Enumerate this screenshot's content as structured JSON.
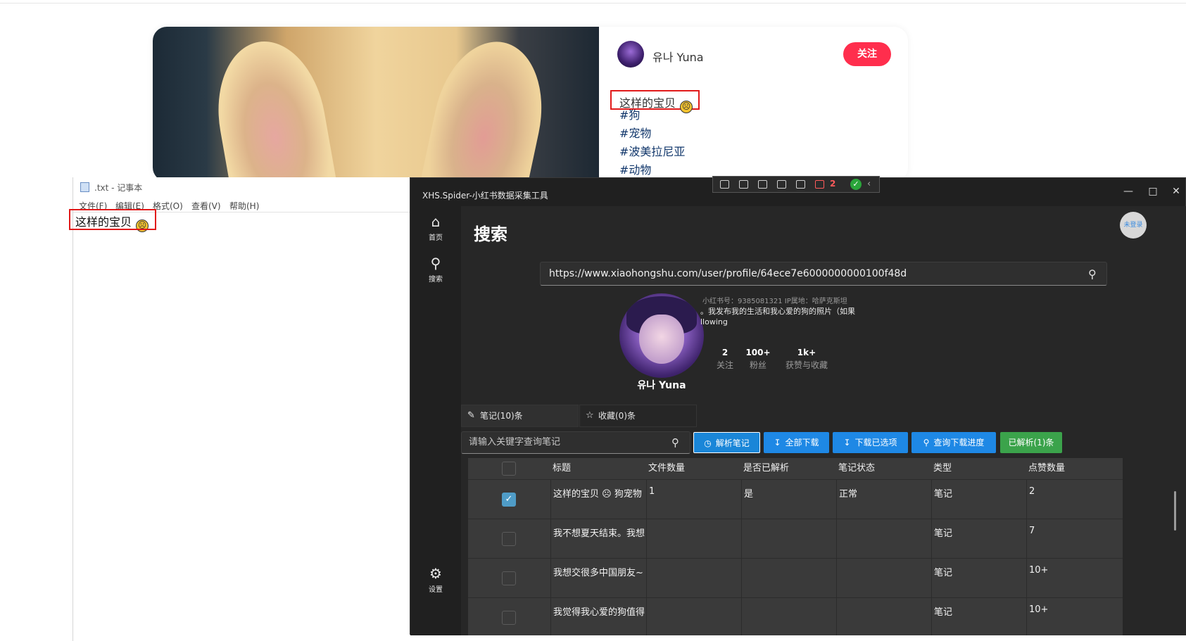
{
  "web": {
    "author_name": "유나 Yuna",
    "follow_label": "关注",
    "note_title": "这样的宝贝",
    "note_emoji": "☹",
    "tags": [
      "#狗",
      "#宠物",
      "#波美拉尼亚",
      "#动物"
    ]
  },
  "notepad": {
    "title": ".txt - 记事本",
    "menu": [
      "文件(F)",
      "编辑(E)",
      "格式(O)",
      "查看(V)",
      "帮助(H)"
    ],
    "content": "这样的宝贝"
  },
  "toolbar": {
    "count": "2",
    "check": "✓"
  },
  "app": {
    "title": "XHS.Spider-小红书数据采集工具",
    "sidebar": {
      "items": [
        {
          "label": "首页",
          "icon": "home-icon"
        },
        {
          "label": "搜索",
          "icon": "search-icon"
        }
      ],
      "settings_label": "设置"
    },
    "page_title": "搜索",
    "login_badge": "未登录",
    "search": {
      "value": "https://www.xiaohongshu.com/user/profile/64ece7e6000000000100f48d"
    },
    "profile": {
      "xhs_id": "小红书号：9385081321   IP属地：哈萨克斯坦",
      "bio": "。我发布我的生活和我心爱的狗的照片（如果\nllowing",
      "name": "유나 Yuna",
      "stats": [
        {
          "value": "2",
          "label": "关注"
        },
        {
          "value": "100+",
          "label": "粉丝"
        },
        {
          "value": "1k+",
          "label": "获赞与收藏"
        }
      ]
    },
    "tabs": [
      {
        "label": "笔记(10)条"
      },
      {
        "label": "收藏(0)条"
      }
    ],
    "filter_placeholder": "请输入关键字查询笔记",
    "actions": {
      "parse": "解析笔记",
      "download_all": "全部下载",
      "download_selected": "下载已选项",
      "query_progress": "查询下载进度",
      "parsed_count": "已解析(1)条"
    },
    "table": {
      "columns": [
        "标题",
        "文件数量",
        "是否已解析",
        "笔记状态",
        "类型",
        "点赞数量"
      ],
      "rows": [
        {
          "checked": true,
          "title": "这样的宝贝 ☹ 狗宠物",
          "files": "1",
          "parsed": "是",
          "status": "正常",
          "type": "笔记",
          "likes": "2"
        },
        {
          "checked": false,
          "title": "我不想夏天结束。我想",
          "files": "",
          "parsed": "",
          "status": "",
          "type": "笔记",
          "likes": "7"
        },
        {
          "checked": false,
          "title": "我想交很多中国朋友~",
          "files": "",
          "parsed": "",
          "status": "",
          "type": "笔记",
          "likes": "10+"
        },
        {
          "checked": false,
          "title": "我觉得我心爱的狗值得",
          "files": "",
          "parsed": "",
          "status": "",
          "type": "笔记",
          "likes": "10+"
        }
      ]
    }
  }
}
